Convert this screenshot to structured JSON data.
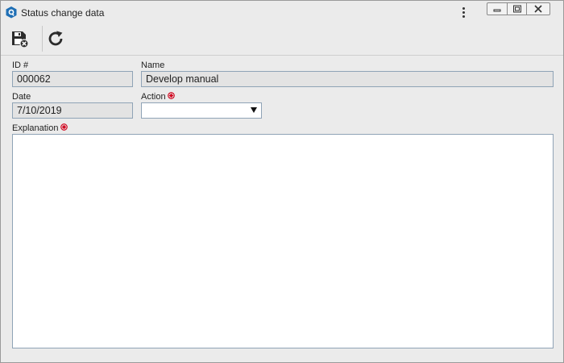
{
  "window": {
    "title": "Status change data",
    "icons": {
      "app": "app-logo-icon",
      "menu": "more-vertical-icon",
      "minimize": "minimize-icon",
      "maximize": "restore-icon",
      "close": "close-icon"
    }
  },
  "toolbar": {
    "save_icon": "save-and-close-icon",
    "refresh_icon": "refresh-icon"
  },
  "form": {
    "id_label": "ID #",
    "id_value": "000062",
    "name_label": "Name",
    "name_value": "Develop manual",
    "date_label": "Date",
    "date_value": "7/10/2019",
    "action_label": "Action",
    "action_value": "",
    "explanation_label": "Explanation",
    "explanation_value": "",
    "required_icon": "required-field-icon"
  },
  "colors": {
    "window_bg": "#ebebeb",
    "field_border": "#8fa3b6",
    "readonly_bg": "#e3e3e3",
    "required": "#d0021b"
  }
}
